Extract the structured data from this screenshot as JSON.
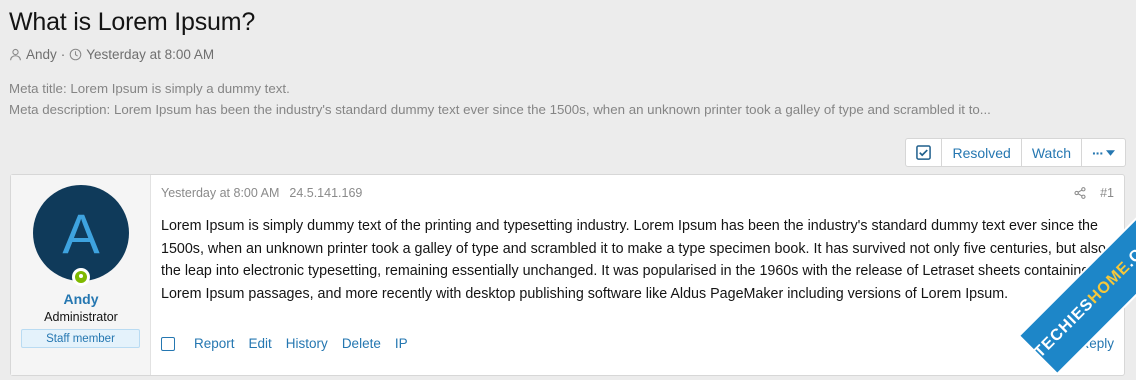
{
  "thread": {
    "title": "What is Lorem Ipsum?",
    "author": "Andy",
    "separator": "·",
    "date": "Yesterday at 8:00 AM"
  },
  "meta": {
    "title_line": "Meta title: Lorem Ipsum is simply a dummy text.",
    "description_line": "Meta description: Lorem Ipsum has been the industry's standard dummy text ever since the 1500s, when an unknown printer took a galley of type and scrambled it to..."
  },
  "actions": {
    "resolved": "Resolved",
    "watch": "Watch",
    "more": "···"
  },
  "post": {
    "date": "Yesterday at 8:00 AM",
    "ip": "24.5.141.169",
    "number": "#1",
    "body": "Lorem Ipsum is simply dummy text of the printing and typesetting industry. Lorem Ipsum has been the industry's standard dummy text ever since the 1500s, when an unknown printer took a galley of type and scrambled it to make a type specimen book. It has survived not only five centuries, but also the leap into electronic typesetting, remaining essentially unchanged. It was popularised in the 1960s with the release of Letraset sheets containing Lorem Ipsum passages, and more recently with desktop publishing software like Aldus PageMaker including versions of Lorem Ipsum.",
    "footer": {
      "report": "Report",
      "edit": "Edit",
      "history": "History",
      "delete": "Delete",
      "ip": "IP",
      "reply": "Reply"
    }
  },
  "user": {
    "avatar_letter": "A",
    "name": "Andy",
    "title": "Administrator",
    "badge": "Staff member",
    "status": "online"
  },
  "watermark": {
    "part1": "TECHIES",
    "part2": "HOME",
    "part3": ".COM"
  },
  "colors": {
    "link": "#2577b1",
    "avatar_bg": "#0f3a5a",
    "avatar_letter": "#3ea3df",
    "online": "#7fb900",
    "watermark": "#1d86c8"
  }
}
